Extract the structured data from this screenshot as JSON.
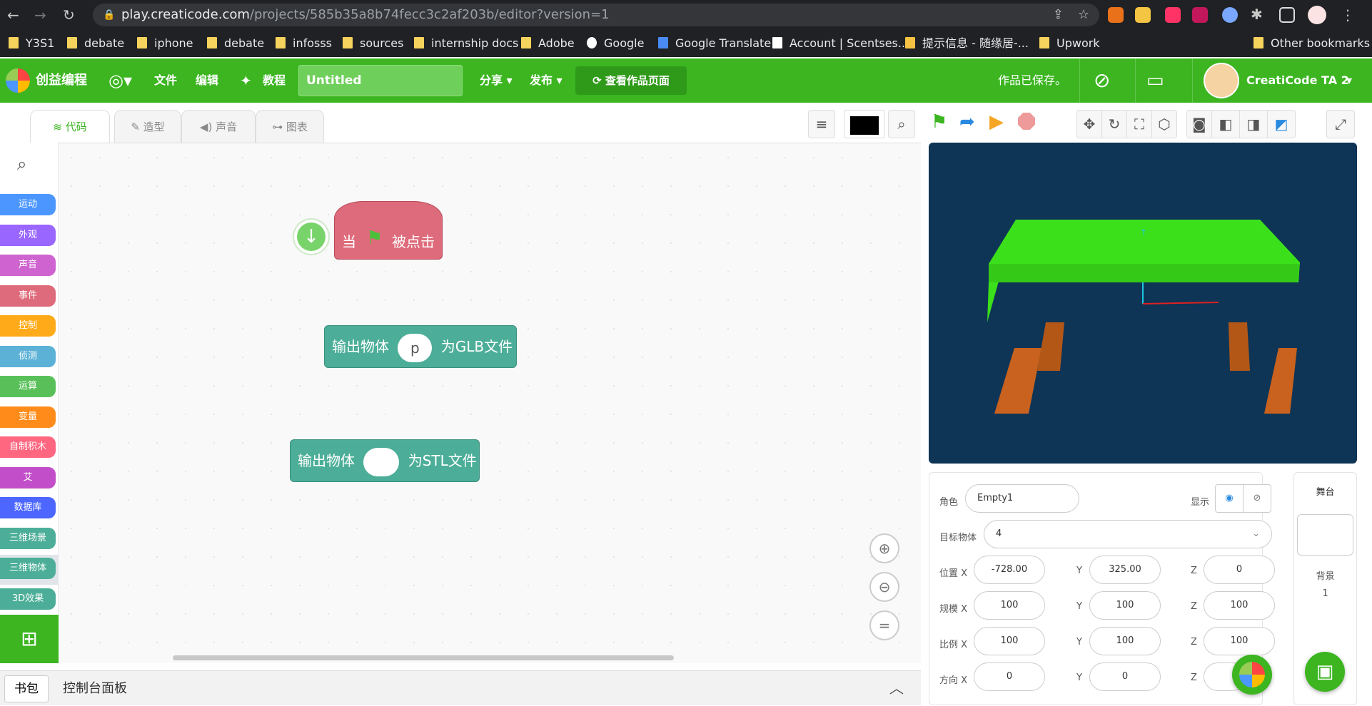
{
  "browser": {
    "url_host": "play.creaticode.com",
    "url_path": "/projects/585b35a8b74fecc3c2af203b/editor?version=1"
  },
  "bookmarks": [
    "Y3S1",
    "debate",
    "iphone",
    "debate",
    "infosss",
    "sources",
    "internship docs",
    "Adobe",
    "Google",
    "Google Translate",
    "Account | Scentses...",
    "提示信息 - 随缘居-...",
    "Upwork",
    "Other bookmarks"
  ],
  "topbar": {
    "brand": "创益编程",
    "menu_file": "文件",
    "menu_edit": "编辑",
    "menu_tutorial": "教程",
    "project_title": "Untitled",
    "menu_share": "分享",
    "menu_publish": "发布",
    "view_page": "查看作品页面",
    "saved_status": "作品已保存。",
    "username": "CreatiCode TA 2"
  },
  "tabs": {
    "code": "代码",
    "costumes": "造型",
    "sounds": "声音",
    "charts": "图表"
  },
  "categories": [
    {
      "label": "运动",
      "color": "#4c97ff"
    },
    {
      "label": "外观",
      "color": "#9966ff"
    },
    {
      "label": "声音",
      "color": "#cf63cf"
    },
    {
      "label": "事件",
      "color": "#de6b7b"
    },
    {
      "label": "控制",
      "color": "#ffab19"
    },
    {
      "label": "侦测",
      "color": "#5cb1d6"
    },
    {
      "label": "运算",
      "color": "#59c059"
    },
    {
      "label": "变量",
      "color": "#ff8c1a"
    },
    {
      "label": "自制积木",
      "color": "#ff6680"
    },
    {
      "label": "艾",
      "color": "#c24fc9"
    },
    {
      "label": "数据库",
      "color": "#4c66ff"
    },
    {
      "label": "三维场景",
      "color": "#4cae98"
    },
    {
      "label": "三维物体",
      "color": "#4cae98"
    },
    {
      "label": "3D效果",
      "color": "#4cae98"
    }
  ],
  "blocks": {
    "hat_when": "当",
    "hat_clicked": "被点击",
    "glb_prefix": "输出物体",
    "glb_arg": "p",
    "glb_suffix": "为GLB文件",
    "stl_prefix": "输出物体",
    "stl_arg": "",
    "stl_suffix": "为STL文件"
  },
  "bottom": {
    "backpack": "书包",
    "console": "控制台面板"
  },
  "props": {
    "sprite_label": "角色",
    "sprite_name": "Empty1",
    "show_label": "显示",
    "target_label": "目标物体",
    "target_value": "4",
    "position_label": "位置 X",
    "pos_x": "-728.00",
    "pos_y": "325.00",
    "pos_z": "0",
    "scale_label": "规模 X",
    "scale_x": "100",
    "scale_y": "100",
    "scale_z": "100",
    "ratio_label": "比例 X",
    "ratio_x": "100",
    "ratio_y": "100",
    "ratio_z": "100",
    "direction_label": "方向 X",
    "dir_x": "0",
    "dir_y": "0",
    "y": "Y",
    "z": "Z"
  },
  "stage_panel": {
    "title": "舞台",
    "backdrop_label": "背景",
    "backdrop_count": "1"
  },
  "colors": {
    "brand_green": "#3cb521",
    "stage_bg": "#0e3456",
    "table_top": "#3be01a",
    "table_leg": "#c8621e"
  }
}
